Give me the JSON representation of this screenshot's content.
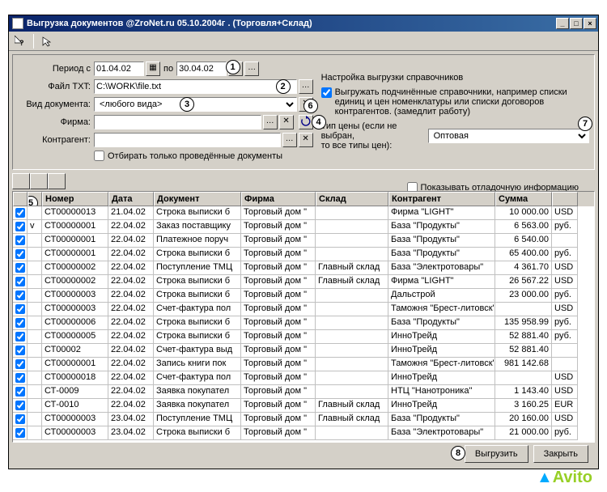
{
  "window": {
    "title": "Выгрузка документов  @ZroNet.ru 05.10.2004г .  (Торговля+Склад)"
  },
  "form": {
    "period_label": "Период с",
    "period_from": "01.04.02",
    "period_to_label": "по",
    "period_to": "30.04.02",
    "file_label": "Файл TXT:",
    "file_value": "C:\\WORK\\file.txt",
    "doc_type_label": "Вид документа:",
    "doc_type_value": "<любого вида>",
    "firm_label": "Фирма:",
    "firm_value": "",
    "contractor_label": "Контрагент:",
    "contractor_value": "",
    "only_posted_label": "Отбирать только проведённые документы",
    "refs_title": "Настройка выгрузки справочников",
    "refs_sub_label": "Выгружать подчинённые справочники, например списки единиц и цен номенклатуры или списки договоров контрагентов.  (замедлит работу)",
    "price_type_label1": "Тип цены (если не выбран,",
    "price_type_label2": "то все типы цен):",
    "price_type_value": "Оптовая",
    "debug_label": "Показывать отладочную информацию"
  },
  "table": {
    "columns": [
      "",
      "",
      "Номер",
      "Дата",
      "Документ",
      "Фирма",
      "Склад",
      "Контрагент",
      "Сумма",
      ""
    ],
    "rows": [
      {
        "c1": true,
        "c2": "",
        "num": "СТ00000013",
        "date": "21.04.02",
        "doc": "Строка выписки б",
        "firm": "Торговый дом \"",
        "wh": "",
        "ctr": "Фирма \"LIGHT\"",
        "sum": "10 000.00",
        "cur": "USD"
      },
      {
        "c1": true,
        "c2": "v",
        "num": "СТ00000001",
        "date": "22.04.02",
        "doc": "Заказ поставщику",
        "firm": "Торговый дом \"",
        "wh": "",
        "ctr": "База \"Продукты\"",
        "sum": "6 563.00",
        "cur": "руб."
      },
      {
        "c1": true,
        "c2": "",
        "num": "СТ00000001",
        "date": "22.04.02",
        "doc": "Платежное поруч",
        "firm": "Торговый дом \"",
        "wh": "",
        "ctr": "База \"Продукты\"",
        "sum": "6 540.00",
        "cur": ""
      },
      {
        "c1": true,
        "c2": "",
        "num": "СТ00000001",
        "date": "22.04.02",
        "doc": "Строка выписки б",
        "firm": "Торговый дом \"",
        "wh": "",
        "ctr": "База \"Продукты\"",
        "sum": "65 400.00",
        "cur": "руб."
      },
      {
        "c1": true,
        "c2": "",
        "num": "СТ00000002",
        "date": "22.04.02",
        "doc": "Поступление ТМЦ",
        "firm": "Торговый дом \"",
        "wh": "Главный склад",
        "ctr": "База \"Электротовары\"",
        "sum": "4 361.70",
        "cur": "USD"
      },
      {
        "c1": true,
        "c2": "",
        "num": "СТ00000002",
        "date": "22.04.02",
        "doc": "Строка выписки б",
        "firm": "Торговый дом \"",
        "wh": "Главный склад",
        "ctr": "Фирма \"LIGHT\"",
        "sum": "26 567.22",
        "cur": "USD"
      },
      {
        "c1": true,
        "c2": "",
        "num": "СТ00000003",
        "date": "22.04.02",
        "doc": "Строка выписки б",
        "firm": "Торговый дом \"",
        "wh": "",
        "ctr": "Дальстрой",
        "sum": "23 000.00",
        "cur": "руб."
      },
      {
        "c1": true,
        "c2": "",
        "num": "СТ00000003",
        "date": "22.04.02",
        "doc": "Счет-фактура пол",
        "firm": "Торговый дом \"",
        "wh": "",
        "ctr": "Таможня \"Брест-литовск\"",
        "sum": "",
        "cur": "USD"
      },
      {
        "c1": true,
        "c2": "",
        "num": "СТ00000006",
        "date": "22.04.02",
        "doc": "Строка выписки б",
        "firm": "Торговый дом \"",
        "wh": "",
        "ctr": "База \"Продукты\"",
        "sum": "135 958.99",
        "cur": "руб."
      },
      {
        "c1": true,
        "c2": "",
        "num": "СТ00000005",
        "date": "22.04.02",
        "doc": "Строка выписки б",
        "firm": "Торговый дом \"",
        "wh": "",
        "ctr": "ИнноТрейд",
        "sum": "52 881.40",
        "cur": "руб."
      },
      {
        "c1": true,
        "c2": "",
        "num": "СТ00002",
        "date": "22.04.02",
        "doc": "Счет-фактура выд",
        "firm": "Торговый дом \"",
        "wh": "",
        "ctr": "ИнноТрейд",
        "sum": "52 881.40",
        "cur": ""
      },
      {
        "c1": true,
        "c2": "",
        "num": "СТ00000001",
        "date": "22.04.02",
        "doc": "Запись книги пок",
        "firm": "Торговый дом \"",
        "wh": "",
        "ctr": "Таможня \"Брест-литовск\"",
        "sum": "981 142.68",
        "cur": ""
      },
      {
        "c1": true,
        "c2": "",
        "num": "СТ00000018",
        "date": "22.04.02",
        "doc": "Счет-фактура пол",
        "firm": "Торговый дом \"",
        "wh": "",
        "ctr": "ИнноТрейд",
        "sum": "",
        "cur": "USD"
      },
      {
        "c1": true,
        "c2": "",
        "num": "СТ-0009",
        "date": "22.04.02",
        "doc": "Заявка покупател",
        "firm": "Торговый дом \"",
        "wh": "",
        "ctr": "НТЦ \"Нанотроника\"",
        "sum": "1 143.40",
        "cur": "USD"
      },
      {
        "c1": true,
        "c2": "",
        "num": "СТ-0010",
        "date": "22.04.02",
        "doc": "Заявка покупател",
        "firm": "Торговый дом \"",
        "wh": "Главный склад",
        "ctr": "ИнноТрейд",
        "sum": "3 160.25",
        "cur": "EUR"
      },
      {
        "c1": true,
        "c2": "",
        "num": "СТ00000003",
        "date": "23.04.02",
        "doc": "Поступление ТМЦ",
        "firm": "Торговый дом \"",
        "wh": "Главный склад",
        "ctr": "База \"Продукты\"",
        "sum": "20 160.00",
        "cur": "USD"
      },
      {
        "c1": true,
        "c2": "",
        "num": "СТ00000003",
        "date": "23.04.02",
        "doc": "Строка выписки б",
        "firm": "Торговый дом \"",
        "wh": "",
        "ctr": "База \"Электротовары\"",
        "sum": "21 000.00",
        "cur": "руб."
      }
    ]
  },
  "buttons": {
    "export": "Выгрузить",
    "close": "Закрыть"
  },
  "callouts": [
    "1",
    "2",
    "3",
    "4",
    "5",
    "6",
    "7",
    "8"
  ],
  "watermark": "Avito"
}
